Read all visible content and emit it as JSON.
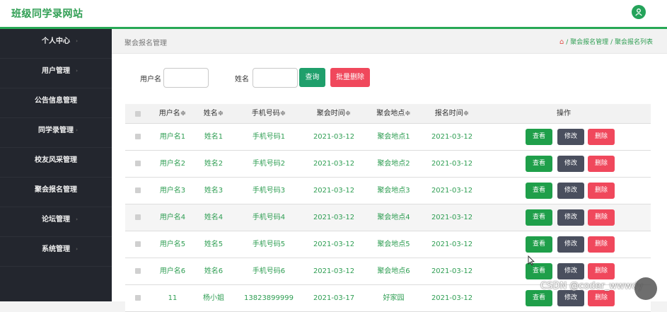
{
  "app": {
    "title": "班级同学录网站"
  },
  "sidebar": {
    "items": [
      {
        "label": "个人中心"
      },
      {
        "label": "用户管理"
      },
      {
        "label": "公告信息管理"
      },
      {
        "label": "同学录管理"
      },
      {
        "label": "校友风采管理"
      },
      {
        "label": "聚会报名管理"
      },
      {
        "label": "论坛管理"
      },
      {
        "label": "系统管理"
      }
    ]
  },
  "page": {
    "title": "聚会报名管理",
    "breadcrumb": [
      "聚会报名管理",
      "聚会报名列表"
    ],
    "breadcrumb_sep": "/"
  },
  "search": {
    "username_label": "用户名",
    "username_value": "",
    "name_label": "姓名",
    "name_value": "",
    "query_label": "查询",
    "batch_delete_label": "批量删除"
  },
  "table": {
    "headers": [
      "用户名≑",
      "姓名≑",
      "手机号码≑",
      "聚会时间≑",
      "聚会地点≑",
      "报名时间≑",
      "操作"
    ],
    "rows": [
      [
        "用户名1",
        "姓名1",
        "手机号码1",
        "2021-03-12",
        "聚会地点1",
        "2021-03-12"
      ],
      [
        "用户名2",
        "姓名2",
        "手机号码2",
        "2021-03-12",
        "聚会地点2",
        "2021-03-12"
      ],
      [
        "用户名3",
        "姓名3",
        "手机号码3",
        "2021-03-12",
        "聚会地点3",
        "2021-03-12"
      ],
      [
        "用户名4",
        "姓名4",
        "手机号码4",
        "2021-03-12",
        "聚会地点4",
        "2021-03-12"
      ],
      [
        "用户名5",
        "姓名5",
        "手机号码5",
        "2021-03-12",
        "聚会地点5",
        "2021-03-12"
      ],
      [
        "用户名6",
        "姓名6",
        "手机号码6",
        "2021-03-12",
        "聚会地点6",
        "2021-03-12"
      ],
      [
        "11",
        "杨小姐",
        "13823899999",
        "2021-03-17",
        "好家园",
        "2021-03-12"
      ]
    ],
    "actions": {
      "view": "查看",
      "edit": "修改",
      "delete": "删除"
    }
  },
  "watermark": "CSDN @coder_wwwdy",
  "colors": {
    "brand": "#2f9e53",
    "sidebar": "#23262e",
    "danger": "#f0485c",
    "edit": "#4a4f5e"
  }
}
